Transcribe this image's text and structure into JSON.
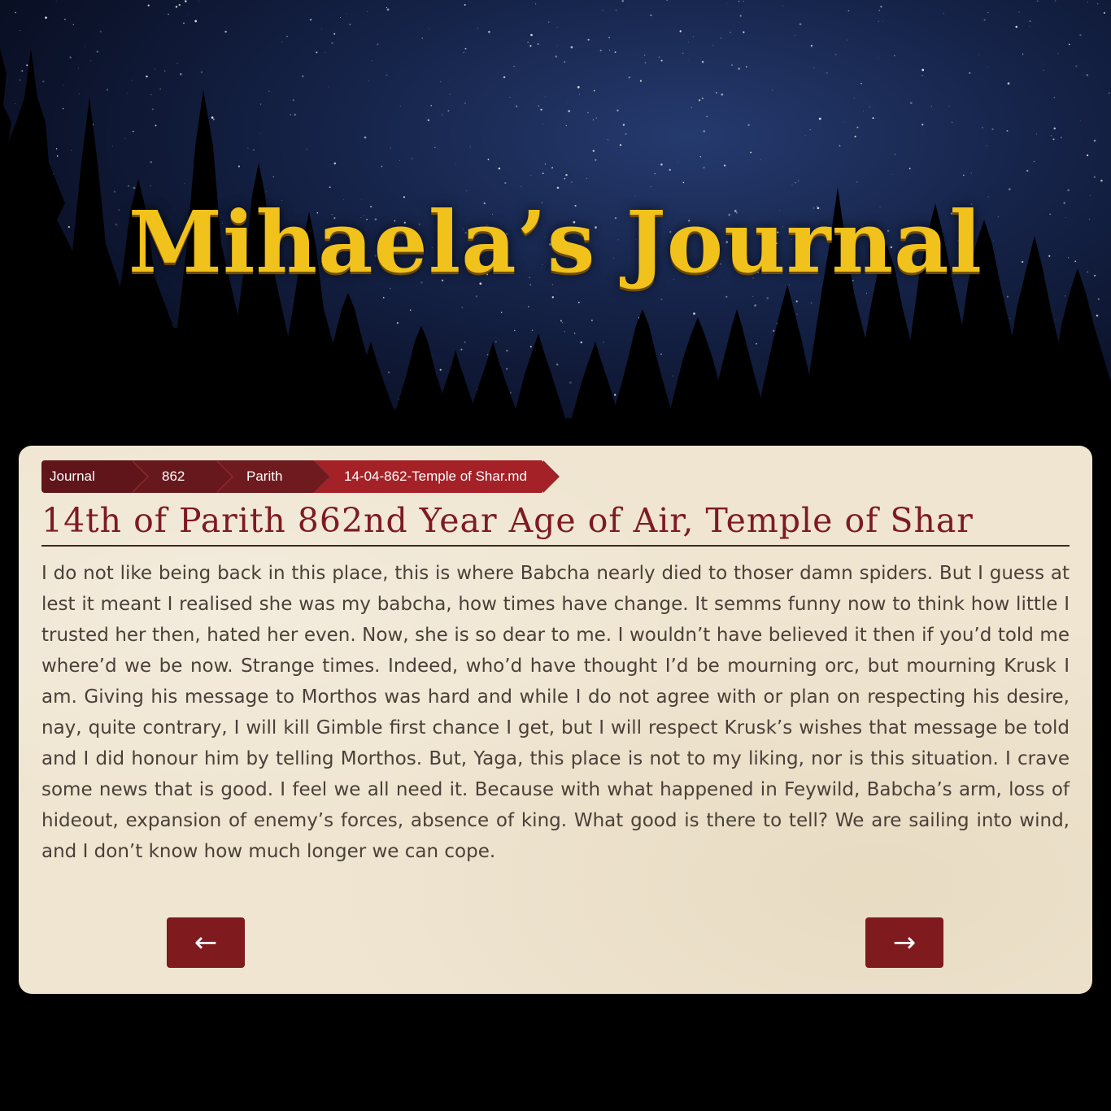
{
  "site": {
    "title": "Mihaela’s Journal"
  },
  "breadcrumb": [
    {
      "label": "Journal"
    },
    {
      "label": "862"
    },
    {
      "label": "Parith"
    },
    {
      "label": "14-04-862-Temple of Shar.md"
    }
  ],
  "entry": {
    "title": "14th of Parith 862nd Year Age of Air, Temple of Shar",
    "body": "I do not like being back in this place, this is where Babcha nearly died to thoser damn spiders. But I guess at lest it meant I realised she was my babcha, how times have change. It semms funny now to think how little I trusted her then, hated her even. Now, she is so dear to me. I wouldn’t have believed it then if you’d told me where’d we be now. Strange times. Indeed, who’d have thought I’d be mourning orc, but mourning Krusk I am. Giving his message to Morthos was hard and while I do not agree with or plan on respecting his desire, nay, quite contrary, I will kill Gimble first chance I get, but I will respect Krusk’s wishes that message be told and I did honour him by telling Morthos. But, Yaga, this place is not to my liking, nor is this situation. I crave some news that is good. I feel we all need it. Because with what happened in Feywild, Babcha’s arm, loss of hideout, expansion of enemy’s forces, absence of king. What good is there to tell? We are sailing into wind, and I don’t know how much longer we can cope."
  },
  "navigation": {
    "prev_icon": "arrow-left-icon",
    "prev_glyph": "←",
    "next_icon": "arrow-right-icon",
    "next_glyph": "→"
  },
  "colors": {
    "title_gold": "#f1c21b",
    "accent_red": "#7f1a1f",
    "heading_red": "#7e1a22",
    "parchment": "#efe5d1"
  }
}
